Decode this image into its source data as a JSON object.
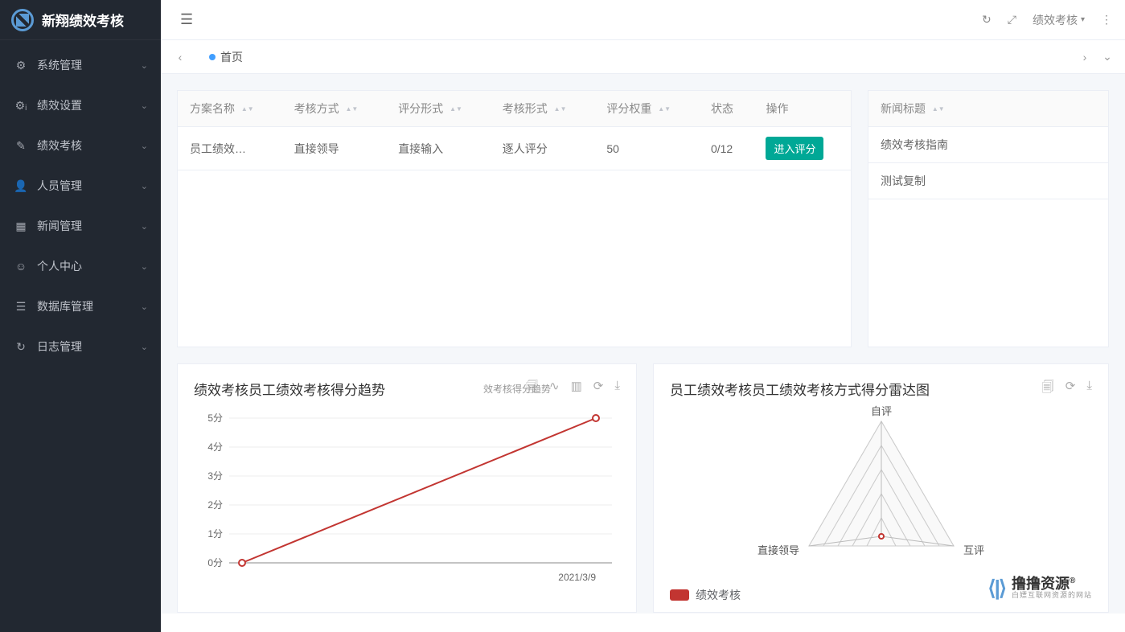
{
  "brand": {
    "name": "新翔绩效考核"
  },
  "sidebar": {
    "items": [
      {
        "label": "系统管理",
        "icon": "gear"
      },
      {
        "label": "绩效设置",
        "icon": "sliders"
      },
      {
        "label": "绩效考核",
        "icon": "edit"
      },
      {
        "label": "人员管理",
        "icon": "user"
      },
      {
        "label": "新闻管理",
        "icon": "news"
      },
      {
        "label": "个人中心",
        "icon": "person"
      },
      {
        "label": "数据库管理",
        "icon": "db"
      },
      {
        "label": "日志管理",
        "icon": "history"
      }
    ]
  },
  "topbar": {
    "dropdown": "绩效考核"
  },
  "tabs": {
    "current": "首页"
  },
  "table": {
    "headers": [
      "方案名称",
      "考核方式",
      "评分形式",
      "考核形式",
      "评分权重",
      "状态",
      "操作"
    ],
    "row": {
      "plan": "员工绩效…",
      "method": "直接领导",
      "scoreType": "直接输入",
      "assessType": "逐人评分",
      "weight": "50",
      "status": "0/12",
      "action": "进入评分"
    }
  },
  "news": {
    "header": "新闻标题",
    "items": [
      "绩效考核指南",
      "测试复制"
    ]
  },
  "chart1": {
    "title": "绩效考核员工绩效考核得分趋势",
    "subtitle": "效考核得分趋势"
  },
  "chart2": {
    "title": "员工绩效考核员工绩效考核方式得分雷达图",
    "legend": "绩效考核",
    "axes": [
      "自评",
      "互评",
      "直接领导"
    ]
  },
  "chart_data": [
    {
      "type": "line",
      "title": "绩效考核员工绩效考核得分趋势",
      "x": [
        "2021/3/9"
      ],
      "series": [
        {
          "name": "得分",
          "values": [
            0,
            5
          ]
        }
      ],
      "ylabel": "分",
      "ylim": [
        0,
        5
      ],
      "xlabel_date": "2021/3/9"
    },
    {
      "type": "radar",
      "title": "员工绩效考核员工绩效考核方式得分雷达图",
      "axes": [
        "自评",
        "互评",
        "直接领导"
      ],
      "series": [
        {
          "name": "绩效考核",
          "values": [
            0,
            0,
            0
          ]
        }
      ],
      "max": 5
    }
  ],
  "watermark": {
    "brand": "撸撸资源",
    "slogan": "白嫖互联网资源的网站"
  }
}
